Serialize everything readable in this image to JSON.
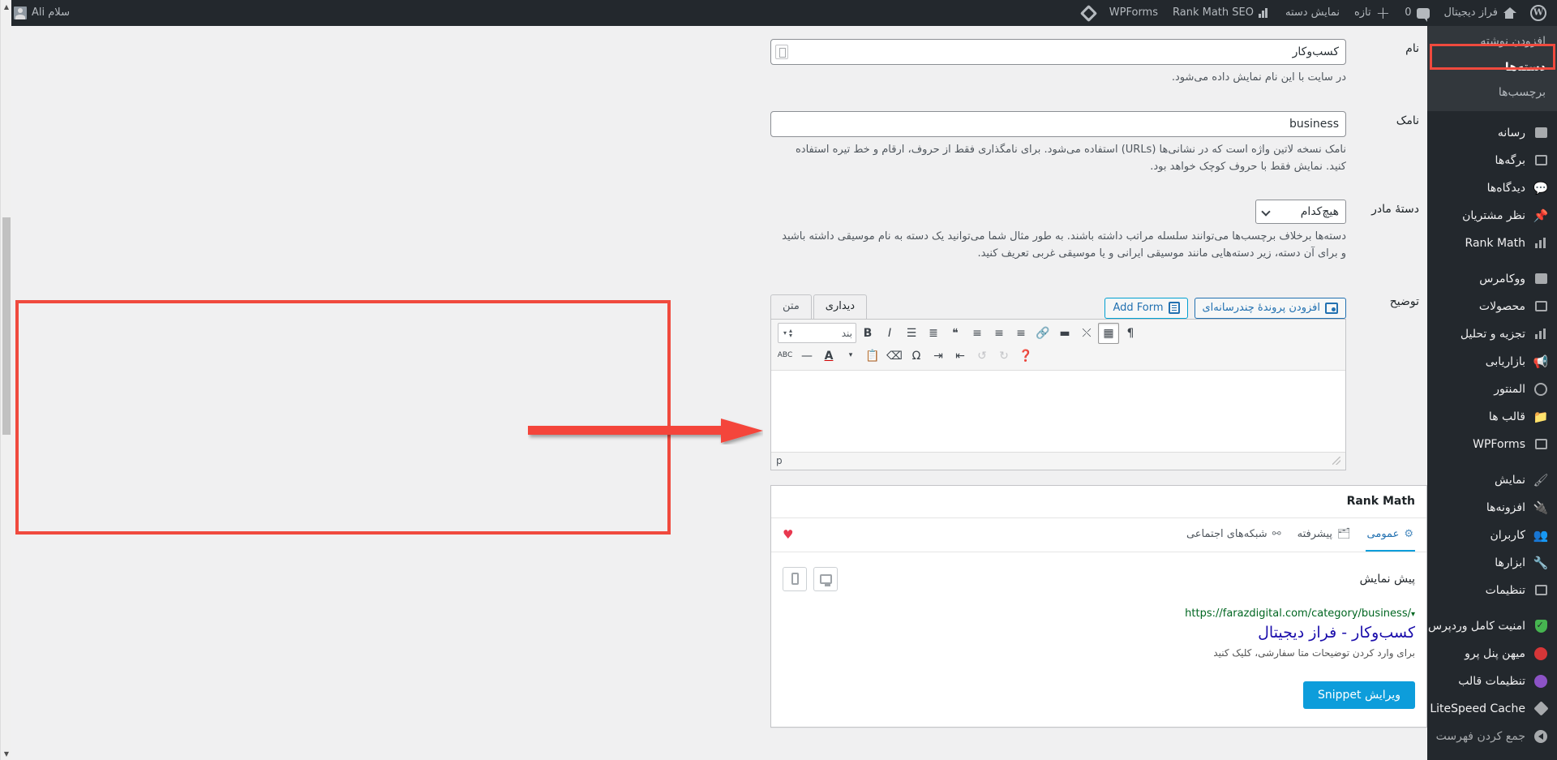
{
  "adminbar": {
    "wp_logo": "wordpress-logo-icon",
    "site_name": "فراز دیجیتال",
    "comments_count": "0",
    "new_label": "تازه",
    "view_category": "نمایش دسته",
    "rank_math_seo": "Rank Math SEO",
    "wpforms": "WPForms",
    "howdy": "سلام Ali"
  },
  "sidebar": {
    "posts_submenu": [
      {
        "label": "افزودن نوشته",
        "current": false
      },
      {
        "label": "دسته‌ها",
        "current": true
      },
      {
        "label": "برچسب‌ها",
        "current": false
      }
    ],
    "items": [
      {
        "label": "رسانه",
        "icon": "media-icon"
      },
      {
        "label": "برگه‌ها",
        "icon": "pages-icon"
      },
      {
        "label": "دیدگاه‌ها",
        "icon": "comments-icon"
      },
      {
        "label": "نظر مشتریان",
        "icon": "pin-icon"
      },
      {
        "label": "Rank Math",
        "icon": "rank-math-icon"
      },
      {
        "label": "ووکامرس",
        "icon": "woocommerce-icon",
        "sep_before": true
      },
      {
        "label": "محصولات",
        "icon": "products-icon"
      },
      {
        "label": "تجزیه و تحلیل",
        "icon": "analytics-icon"
      },
      {
        "label": "بازاریابی",
        "icon": "marketing-icon"
      },
      {
        "label": "المنتور",
        "icon": "elementor-icon"
      },
      {
        "label": "قالب ها",
        "icon": "templates-icon"
      },
      {
        "label": "WPForms",
        "icon": "wpforms-icon"
      },
      {
        "label": "نمایش",
        "icon": "appearance-icon",
        "sep_before": true
      },
      {
        "label": "افزونه‌ها",
        "icon": "plugins-icon"
      },
      {
        "label": "کاربران",
        "icon": "users-icon"
      },
      {
        "label": "ابزارها",
        "icon": "tools-icon"
      },
      {
        "label": "تنظیمات",
        "icon": "settings-icon"
      },
      {
        "label": "امنیت کامل وردپرس",
        "icon": "shield-icon",
        "sep_before": true
      },
      {
        "label": "میهن پنل پرو",
        "icon": "mihan-panel-icon"
      },
      {
        "label": "تنظیمات قالب",
        "icon": "theme-settings-icon"
      },
      {
        "label": "LiteSpeed Cache",
        "icon": "litespeed-icon"
      },
      {
        "label": "جمع کردن فهرست",
        "icon": "collapse-icon"
      }
    ]
  },
  "form": {
    "name": {
      "label": "نام",
      "value": "کسب‌وکار",
      "help": "در سایت با این نام نمایش داده می‌شود."
    },
    "slug": {
      "label": "نامک",
      "value": "business",
      "help": "نامک نسخه لاتین واژه است که در نشانی‌ها (URLs) استفاده می‌شود. برای نامگذاری فقط از حروف، ارقام و خط تیره استفاده کنید. نمایش فقط با حروف کوچک خواهد بود."
    },
    "parent": {
      "label": "دستهٔ مادر",
      "value": "هیچ‌کدام",
      "options": [
        "هیچ‌کدام"
      ],
      "help": "دسته‌ها برخلاف برچسب‌ها می‌توانند سلسله مراتب داشته باشند. به طور مثال شما می‌توانید یک دسته به نام موسیقی داشته باشید و برای آن دسته، زیر دسته‌هایی مانند موسیقی ایرانی و یا موسیقی غربی تعریف کنید."
    },
    "description": {
      "label": "توضیح"
    }
  },
  "editor": {
    "add_media": "افزودن پروندهٔ چندرسانه‌ای",
    "add_form": "Add Form",
    "tab_visual": "دیداری",
    "tab_text": "متن",
    "format_select": "بند",
    "status_path": "p",
    "content": "",
    "toolbar_row1": [
      {
        "name": "bold-button",
        "glyph": "B"
      },
      {
        "name": "italic-button",
        "glyph": "I"
      },
      {
        "name": "bulleted-list-button",
        "glyph": "☰"
      },
      {
        "name": "numbered-list-button",
        "glyph": "≡"
      },
      {
        "name": "blockquote-button",
        "glyph": "❝"
      },
      {
        "name": "align-right-button",
        "glyph": "≡"
      },
      {
        "name": "align-center-button",
        "glyph": "≡"
      },
      {
        "name": "align-left-button",
        "glyph": "≡"
      },
      {
        "name": "link-button",
        "glyph": "🔗"
      },
      {
        "name": "more-tag-button",
        "glyph": "▤"
      },
      {
        "name": "fullscreen-button",
        "glyph": "⤢"
      },
      {
        "name": "toolbar-toggle-button",
        "glyph": "▦"
      },
      {
        "name": "rtl-button",
        "glyph": "¶"
      }
    ],
    "toolbar_row2": [
      {
        "name": "strikethrough-button",
        "glyph": "ABC"
      },
      {
        "name": "horizontal-line-button",
        "glyph": "—"
      },
      {
        "name": "text-color-button",
        "glyph": "A"
      },
      {
        "name": "text-color-dropdown",
        "glyph": "▾"
      },
      {
        "name": "paste-as-text-button",
        "glyph": "📋"
      },
      {
        "name": "clear-formatting-button",
        "glyph": "🧹"
      },
      {
        "name": "special-character-button",
        "glyph": "Ω"
      },
      {
        "name": "outdent-button",
        "glyph": "⇥"
      },
      {
        "name": "indent-button",
        "glyph": "⇤"
      },
      {
        "name": "undo-button",
        "glyph": "↶"
      },
      {
        "name": "redo-button",
        "glyph": "↷"
      },
      {
        "name": "keyboard-help-button",
        "glyph": "?"
      }
    ]
  },
  "rankmath": {
    "title": "Rank Math",
    "tabs": [
      {
        "label": "عمومی",
        "icon": "gear-icon",
        "active": true
      },
      {
        "label": "پیشرفته",
        "icon": "briefcase-icon",
        "active": false
      },
      {
        "label": "شبکه‌های اجتماعی",
        "icon": "share-icon",
        "active": false
      }
    ],
    "preview_label": "پیش نمایش",
    "snippet_url": "https://farazdigital.com/category/business/",
    "snippet_title": "کسب‌وکار - فراز دیجیتال",
    "snippet_desc": "برای وارد کردن توضیحات متا سفارشی، کلیک کنید",
    "edit_snippet_button": "ویرایش Snippet"
  },
  "colors": {
    "annotation_red": "#f04a3e",
    "admin_dark": "#23282d",
    "accent_blue": "#0d9ddb",
    "link_blue": "#1a0dab",
    "url_green": "#006621"
  }
}
